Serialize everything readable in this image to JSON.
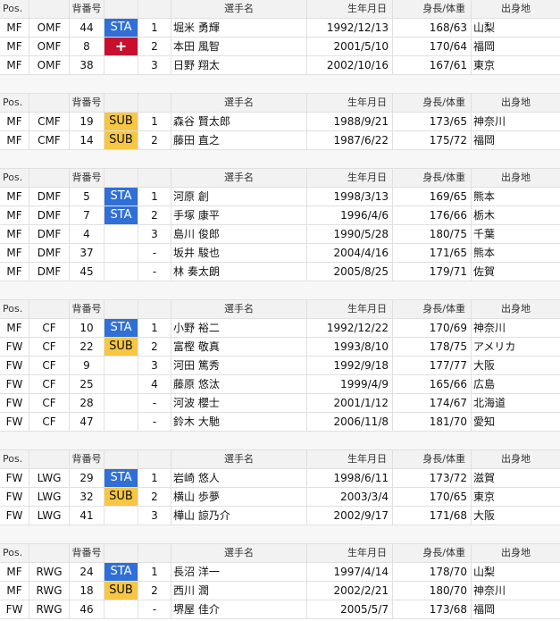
{
  "colors": {
    "sta": "#2f6fd6",
    "sub": "#f7c744",
    "injury": "#c8102e",
    "header_bg": "#f2f2f2"
  },
  "header": {
    "pos": "Pos.",
    "num": "背番号",
    "name": "選手名",
    "dob": "生年月日",
    "hw": "身長/体重",
    "pref": "出身地"
  },
  "groups": [
    {
      "rows": [
        {
          "pos": "MF",
          "role": "OMF",
          "num": "44",
          "status": "STA",
          "order": "1",
          "name": "堀米 勇輝",
          "dob": "1992/12/13",
          "hw": "168/63",
          "pref": "山梨"
        },
        {
          "pos": "MF",
          "role": "OMF",
          "num": "8",
          "status": "INJ",
          "status_icon": "red-cross-icon",
          "status_text": "+",
          "order": "2",
          "name": "本田 風智",
          "dob": "2001/5/10",
          "hw": "170/64",
          "pref": "福岡"
        },
        {
          "pos": "MF",
          "role": "OMF",
          "num": "38",
          "status": "",
          "order": "3",
          "name": "日野 翔太",
          "dob": "2002/10/16",
          "hw": "167/61",
          "pref": "東京"
        }
      ]
    },
    {
      "rows": [
        {
          "pos": "MF",
          "role": "CMF",
          "num": "19",
          "status": "SUB",
          "order": "1",
          "name": "森谷 賢太郎",
          "dob": "1988/9/21",
          "hw": "173/65",
          "pref": "神奈川"
        },
        {
          "pos": "MF",
          "role": "CMF",
          "num": "14",
          "status": "SUB",
          "order": "2",
          "name": "藤田 直之",
          "dob": "1987/6/22",
          "hw": "175/72",
          "pref": "福岡"
        }
      ]
    },
    {
      "rows": [
        {
          "pos": "MF",
          "role": "DMF",
          "num": "5",
          "status": "STA",
          "order": "1",
          "name": "河原 創",
          "dob": "1998/3/13",
          "hw": "169/65",
          "pref": "熊本"
        },
        {
          "pos": "MF",
          "role": "DMF",
          "num": "7",
          "status": "STA",
          "order": "2",
          "name": "手塚 康平",
          "dob": "1996/4/6",
          "hw": "176/66",
          "pref": "栃木"
        },
        {
          "pos": "MF",
          "role": "DMF",
          "num": "4",
          "status": "",
          "order": "3",
          "name": "島川 俊郎",
          "dob": "1990/5/28",
          "hw": "180/75",
          "pref": "千葉"
        },
        {
          "pos": "MF",
          "role": "DMF",
          "num": "37",
          "status": "",
          "order": "-",
          "name": "坂井 駿也",
          "dob": "2004/4/16",
          "hw": "171/65",
          "pref": "熊本"
        },
        {
          "pos": "MF",
          "role": "DMF",
          "num": "45",
          "status": "",
          "order": "-",
          "name": "林 奏太朗",
          "dob": "2005/8/25",
          "hw": "179/71",
          "pref": "佐賀"
        }
      ]
    },
    {
      "rows": [
        {
          "pos": "MF",
          "role": "CF",
          "num": "10",
          "status": "STA",
          "order": "1",
          "name": "小野 裕二",
          "dob": "1992/12/22",
          "hw": "170/69",
          "pref": "神奈川"
        },
        {
          "pos": "FW",
          "role": "CF",
          "num": "22",
          "status": "SUB",
          "order": "2",
          "name": "富樫 敬真",
          "dob": "1993/8/10",
          "hw": "178/75",
          "pref": "アメリカ"
        },
        {
          "pos": "FW",
          "role": "CF",
          "num": "9",
          "status": "",
          "order": "3",
          "name": "河田 篤秀",
          "dob": "1992/9/18",
          "hw": "177/77",
          "pref": "大阪"
        },
        {
          "pos": "FW",
          "role": "CF",
          "num": "25",
          "status": "",
          "order": "4",
          "name": "藤原 悠汰",
          "dob": "1999/4/9",
          "hw": "165/66",
          "pref": "広島"
        },
        {
          "pos": "FW",
          "role": "CF",
          "num": "28",
          "status": "",
          "order": "-",
          "name": "河波 櫻士",
          "dob": "2001/1/12",
          "hw": "174/67",
          "pref": "北海道"
        },
        {
          "pos": "FW",
          "role": "CF",
          "num": "47",
          "status": "",
          "order": "-",
          "name": "鈴木 大馳",
          "dob": "2006/11/8",
          "hw": "181/70",
          "pref": "愛知"
        }
      ]
    },
    {
      "rows": [
        {
          "pos": "FW",
          "role": "LWG",
          "num": "29",
          "status": "STA",
          "order": "1",
          "name": "岩崎 悠人",
          "dob": "1998/6/11",
          "hw": "173/72",
          "pref": "滋賀"
        },
        {
          "pos": "FW",
          "role": "LWG",
          "num": "32",
          "status": "SUB",
          "order": "2",
          "name": "横山 歩夢",
          "dob": "2003/3/4",
          "hw": "170/65",
          "pref": "東京"
        },
        {
          "pos": "FW",
          "role": "LWG",
          "num": "41",
          "status": "",
          "order": "3",
          "name": "樺山 諒乃介",
          "dob": "2002/9/17",
          "hw": "171/68",
          "pref": "大阪"
        }
      ]
    },
    {
      "rows": [
        {
          "pos": "MF",
          "role": "RWG",
          "num": "24",
          "status": "STA",
          "order": "1",
          "name": "長沼 洋一",
          "dob": "1997/4/14",
          "hw": "178/70",
          "pref": "山梨"
        },
        {
          "pos": "MF",
          "role": "RWG",
          "num": "18",
          "status": "SUB",
          "order": "2",
          "name": "西川 潤",
          "dob": "2002/2/21",
          "hw": "180/70",
          "pref": "神奈川"
        },
        {
          "pos": "FW",
          "role": "RWG",
          "num": "46",
          "status": "",
          "order": "-",
          "name": "堺屋 佳介",
          "dob": "2005/5/7",
          "hw": "173/68",
          "pref": "福岡"
        }
      ]
    }
  ]
}
